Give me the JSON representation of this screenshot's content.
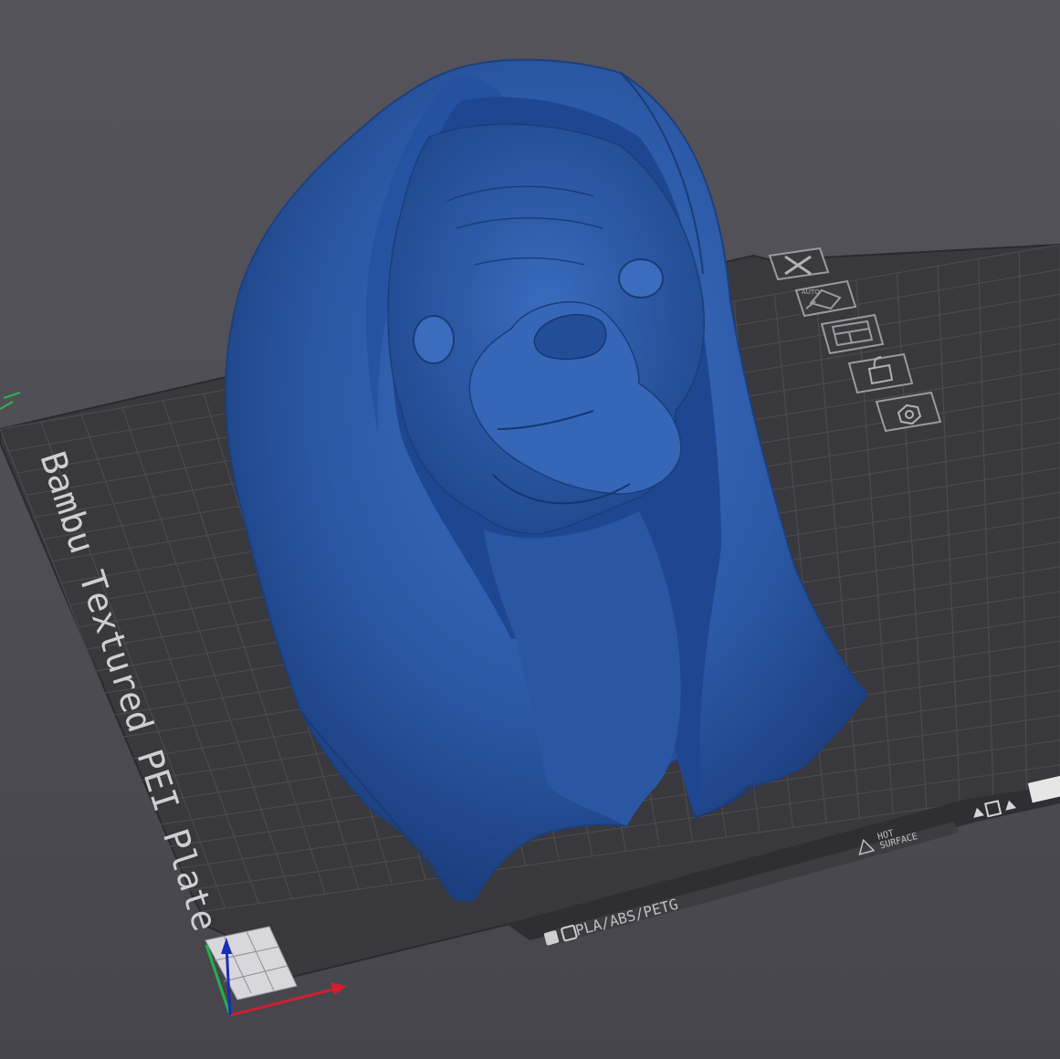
{
  "plate": {
    "name": "Bambu Textured PEI Plate",
    "material_strip": "PLA/ABS/PETG",
    "warning": [
      "HOT",
      "SURFACE"
    ]
  },
  "plate_toolbar": {
    "buttons": [
      {
        "name": "delete-plate-button",
        "icon": "close-icon"
      },
      {
        "name": "auto-orient-button",
        "icon": "auto-orient-icon",
        "label": "AUTO"
      },
      {
        "name": "arrange-button",
        "icon": "arrange-icon"
      },
      {
        "name": "lock-plate-button",
        "icon": "unlock-icon"
      },
      {
        "name": "plate-settings-button",
        "icon": "gear-icon"
      }
    ]
  },
  "model": {
    "name": "hooded pug bust",
    "color": "#2c5aa7"
  },
  "colors": {
    "background": "#4f4e55",
    "plate": "#38383c",
    "grid": "#4c4c51",
    "model": "#2c5aa7",
    "axis_x": "#d11f2d",
    "axis_y": "#20b24a",
    "axis_z": "#1b2cb8"
  }
}
